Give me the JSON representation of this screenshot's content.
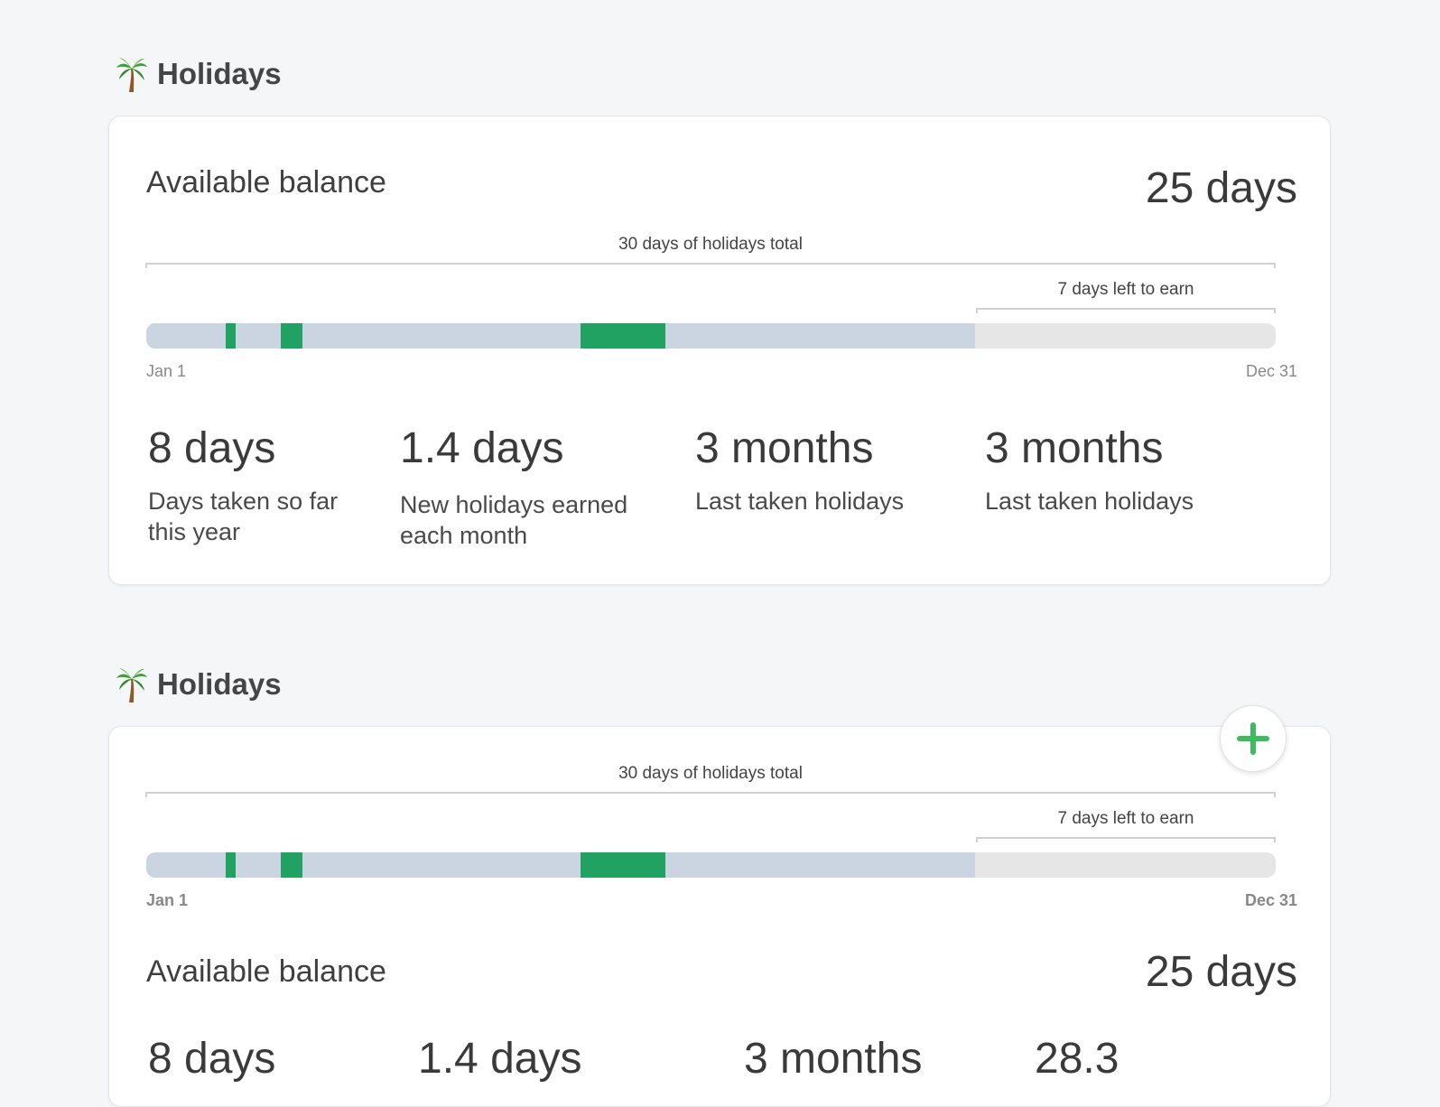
{
  "colors": {
    "taken": "#22a262",
    "elapsed": "#cbd5e1",
    "remaining": "#e6e6e6",
    "fab_plus": "#3dbb5e"
  },
  "icons": {
    "section": "palm-tree-icon",
    "add": "plus-icon"
  },
  "section1": {
    "title": "Holidays",
    "balance_label": "Available balance",
    "balance_value": "25 days",
    "total_label": "30 days of holidays total",
    "left_to_earn_label": "7 days left to earn",
    "start_label": "Jan 1",
    "end_label": "Dec 31",
    "stats": [
      {
        "value": "8 days",
        "desc_line1": "Days taken so far",
        "desc_line2": "this year"
      },
      {
        "value": "1.4 days",
        "desc_line1": "New holidays earned",
        "desc_line2": "each month"
      },
      {
        "value": "3 months",
        "desc_line1": "Last taken holidays",
        "desc_line2": ""
      },
      {
        "value": "3 months",
        "desc_line1": "Last taken holidays",
        "desc_line2": ""
      }
    ]
  },
  "section2": {
    "title": "Holidays",
    "total_label": "30 days of holidays total",
    "left_to_earn_label": "7 days left to earn",
    "start_label": "Jan 1",
    "end_label": "Dec 31",
    "balance_label": "Available balance",
    "balance_value": "25 days",
    "stats": [
      {
        "value": "8 days"
      },
      {
        "value": "1.4 days"
      },
      {
        "value": "3 months"
      },
      {
        "value": "28.3"
      }
    ]
  }
}
